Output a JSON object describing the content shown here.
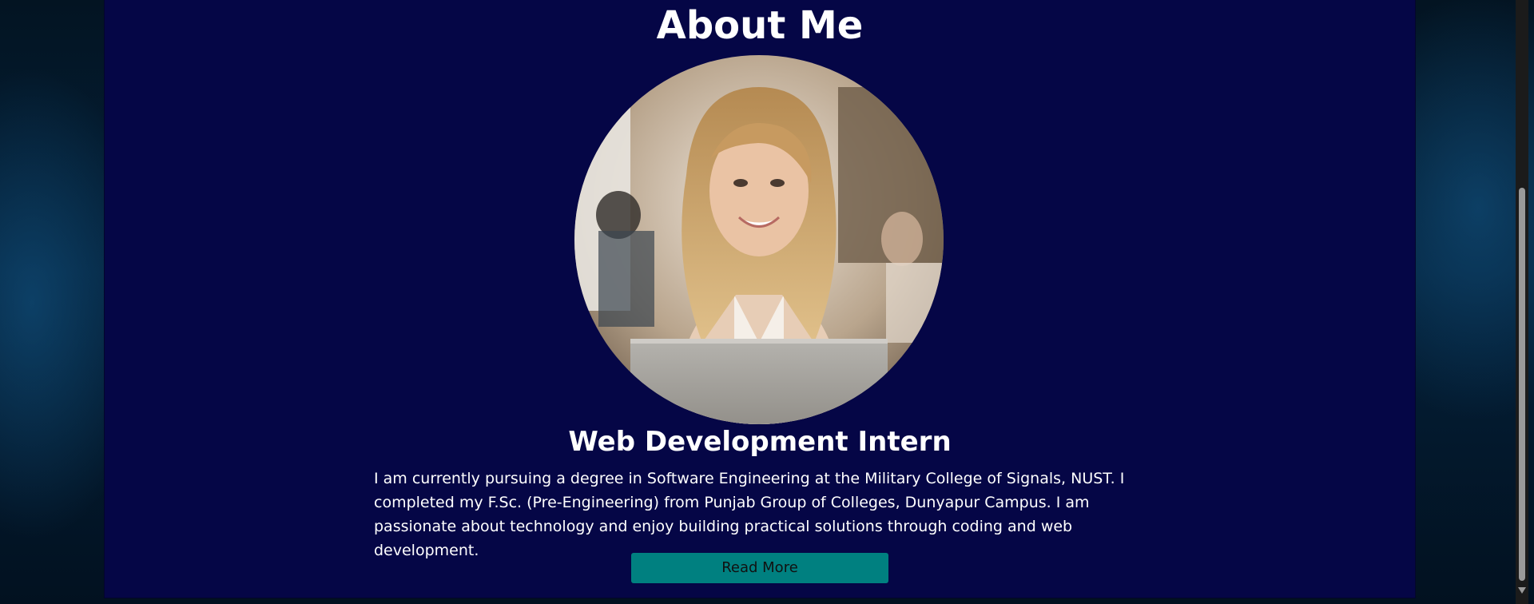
{
  "about": {
    "title": "About Me",
    "role": "Web Development Intern",
    "bio": "I am currently pursuing a degree in Software Engineering at the Military College of Signals, NUST. I completed my F.Sc. (Pre-Engineering) from Punjab Group of Colleges, Dunyapur Campus. I am passionate about technology and enjoy building practical solutions through coding and web development.",
    "button_label": "Read More"
  },
  "colors": {
    "panel_background": "#050646",
    "button_background": "#008080",
    "text": "#ffffff"
  },
  "icons": {
    "scroll_down": "chevron-down-icon"
  }
}
